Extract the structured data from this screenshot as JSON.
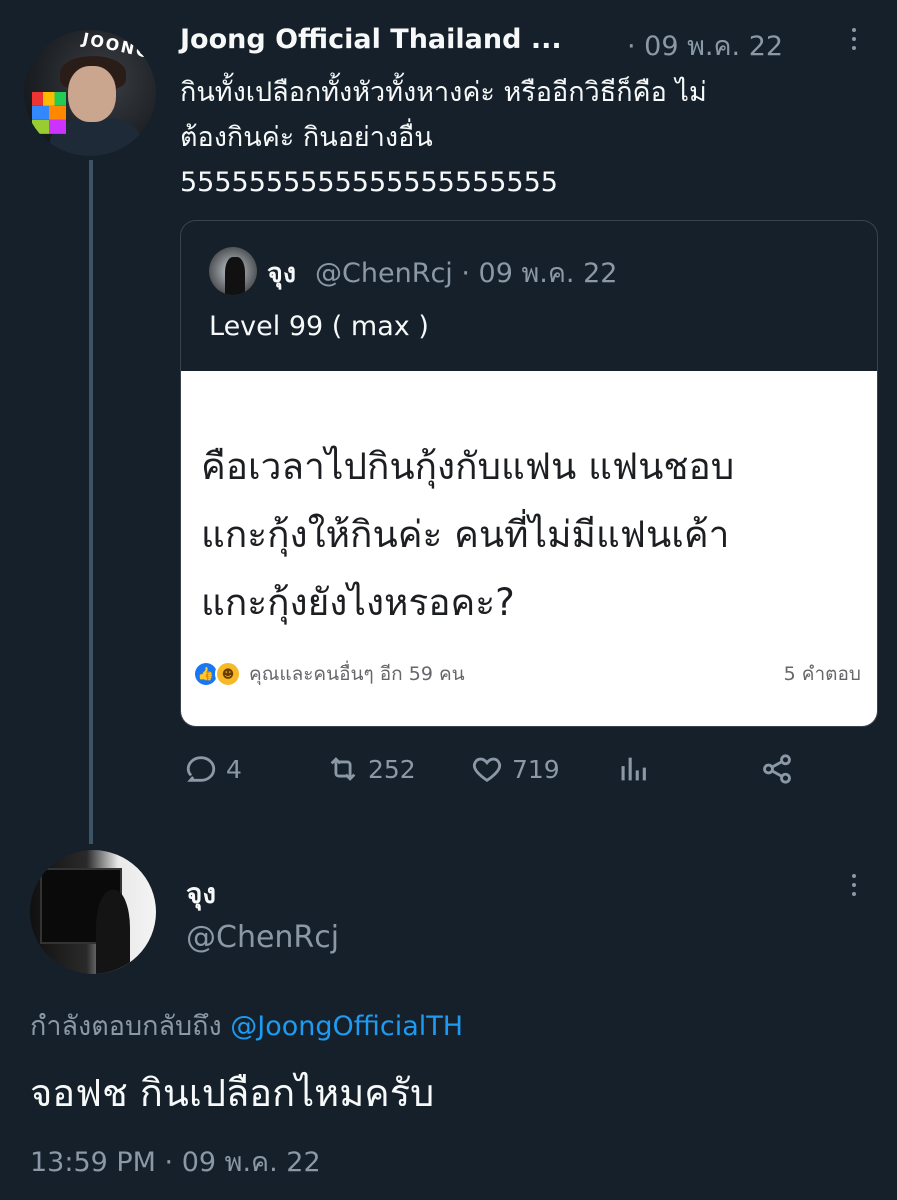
{
  "tweet": {
    "author_name": "Joong Official Thailand ...",
    "meta": "· 09 พ.ค. 22",
    "avatar_text": "JOONG",
    "text_lines": [
      "กินทั้งเปลือกทั้งหัวทั้งหางค่ะ หรืออีกวิธีก็คือ ไม่",
      "ต้องกินค่ะ กินอย่างอื่น",
      "5555555555555555555555"
    ],
    "actions": {
      "replies": "4",
      "retweets": "252",
      "likes": "719"
    }
  },
  "quote": {
    "name": "จุง",
    "meta": "@ChenRcj · 09 พ.ค. 22",
    "text": "Level 99 ( max )",
    "image": {
      "lines": [
        "คือเวลาไปกินกุ้งกับแฟน แฟนชอบ",
        "แกะกุ้งให้กินค่ะ คนที่ไม่มีแฟนเค้า",
        "แกะกุ้งยังไงหรอคะ?"
      ],
      "reactions_text": "คุณและคนอื่นๆ อีก 59 คน",
      "comments_text": "5 คำตอบ"
    }
  },
  "reply": {
    "name": "จุง",
    "handle": "@ChenRcj",
    "replying_prefix": "กำลังตอบกลับถึง ",
    "replying_mention": "@JoongOfficialTH",
    "text": "จอฟช กินเปลือกไหมครับ",
    "timestamp": "13:59 PM · 09 พ.ค. 22"
  },
  "colors": {
    "background": "#15202b",
    "secondary_text": "#8b98a5",
    "link": "#1d9bf0",
    "border": "#38444d"
  },
  "icons": [
    "more-icon",
    "reply-icon",
    "retweet-icon",
    "like-icon",
    "analytics-icon",
    "share-icon",
    "fb-like-icon",
    "fb-haha-icon"
  ]
}
